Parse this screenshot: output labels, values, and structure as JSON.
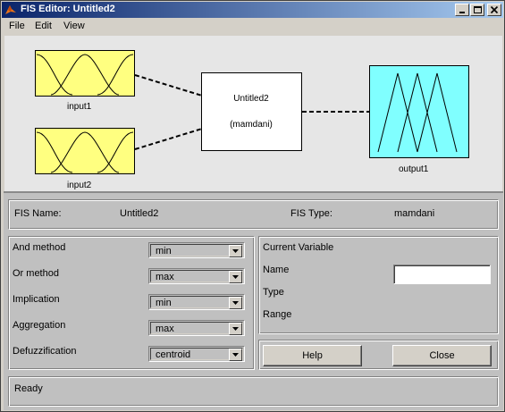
{
  "window": {
    "title": "FIS Editor: Untitled2"
  },
  "menu": [
    "File",
    "Edit",
    "View"
  ],
  "diagram": {
    "inputs": [
      {
        "label": "input1"
      },
      {
        "label": "input2"
      }
    ],
    "system": {
      "name": "Untitled2",
      "type_text": "(mamdani)"
    },
    "output": {
      "label": "output1"
    },
    "colors": {
      "input_fill": "#ffff80",
      "output_fill": "#80ffff",
      "system_fill": "#ffffff"
    }
  },
  "fis_info": {
    "name_label": "FIS Name:",
    "name_value": "Untitled2",
    "type_label": "FIS Type:",
    "type_value": "mamdani"
  },
  "methods": [
    {
      "label": "And method",
      "value": "min"
    },
    {
      "label": "Or method",
      "value": "max"
    },
    {
      "label": "Implication",
      "value": "min"
    },
    {
      "label": "Aggregation",
      "value": "max"
    },
    {
      "label": "Defuzzification",
      "value": "centroid"
    }
  ],
  "current_variable": {
    "title": "Current Variable",
    "name_label": "Name",
    "name_value": "",
    "type_label": "Type",
    "range_label": "Range"
  },
  "buttons": {
    "help": "Help",
    "close": "Close"
  },
  "status": "Ready"
}
